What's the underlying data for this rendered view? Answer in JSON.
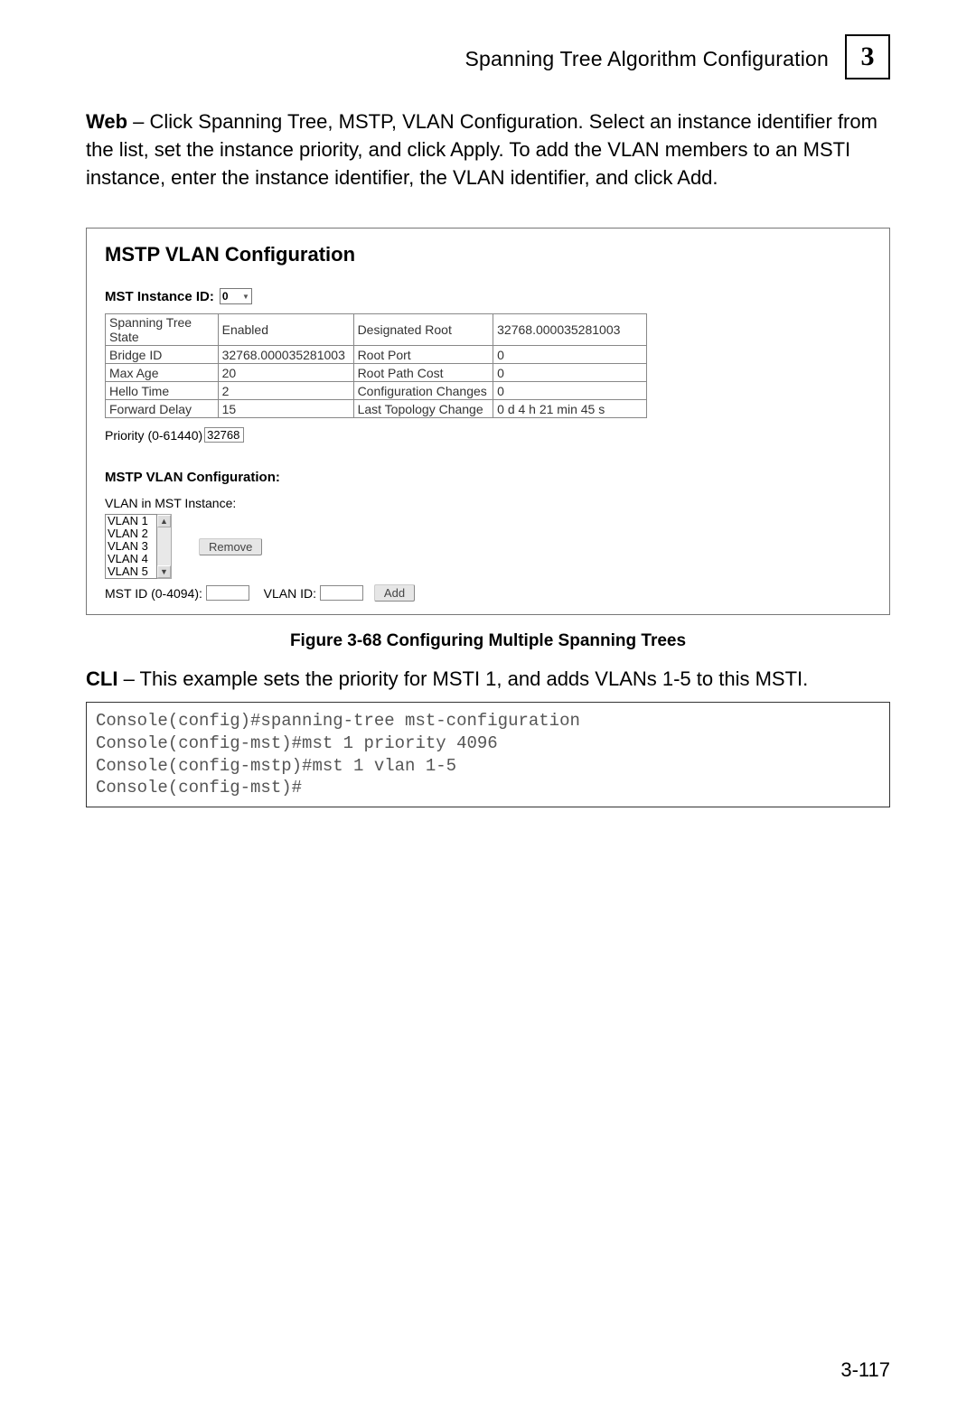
{
  "header": {
    "title": "Spanning Tree Algorithm Configuration",
    "chapter_number": "3"
  },
  "intro": {
    "lead_bold": "Web",
    "text": " – Click Spanning Tree, MSTP, VLAN Configuration. Select an instance identifier from the list, set the instance priority, and click Apply. To add the VLAN members to an MSTI instance, enter the instance identifier, the VLAN identifier, and click Add."
  },
  "screenshot": {
    "title": "MSTP VLAN Configuration",
    "mst_instance_label": "MST Instance ID:",
    "mst_instance_value": "0",
    "info_rows": [
      [
        "Spanning Tree State",
        "Enabled",
        "Designated Root",
        "32768.000035281003"
      ],
      [
        "Bridge ID",
        "32768.000035281003",
        "Root Port",
        "0"
      ],
      [
        "Max Age",
        "20",
        "Root Path Cost",
        "0"
      ],
      [
        "Hello Time",
        "2",
        "Configuration Changes",
        "0"
      ],
      [
        "Forward Delay",
        "15",
        "Last Topology Change",
        "0 d 4 h 21 min 45 s"
      ]
    ],
    "priority_label": "Priority (0-61440)",
    "priority_value": "32768",
    "sub_title": "MSTP VLAN Configuration:",
    "vlan_in_label": "VLAN in MST Instance:",
    "vlan_items": [
      "VLAN 1",
      "VLAN 2",
      "VLAN 3",
      "VLAN 4",
      "VLAN 5"
    ],
    "remove_label": "Remove",
    "mst_id_label": "MST ID (0-4094):",
    "vlan_id_label": "VLAN ID:",
    "add_label": "Add"
  },
  "figure_caption": "Figure 3-68  Configuring Multiple Spanning Trees",
  "cli": {
    "lead_bold": "CLI",
    "text": " – This example sets the priority for MSTI 1, and adds VLANs 1-5 to this MSTI.",
    "lines": "Console(config)#spanning-tree mst-configuration\nConsole(config-mst)#mst 1 priority 4096\nConsole(config-mstp)#mst 1 vlan 1-5\nConsole(config-mst)#"
  },
  "page_number": "3-117"
}
